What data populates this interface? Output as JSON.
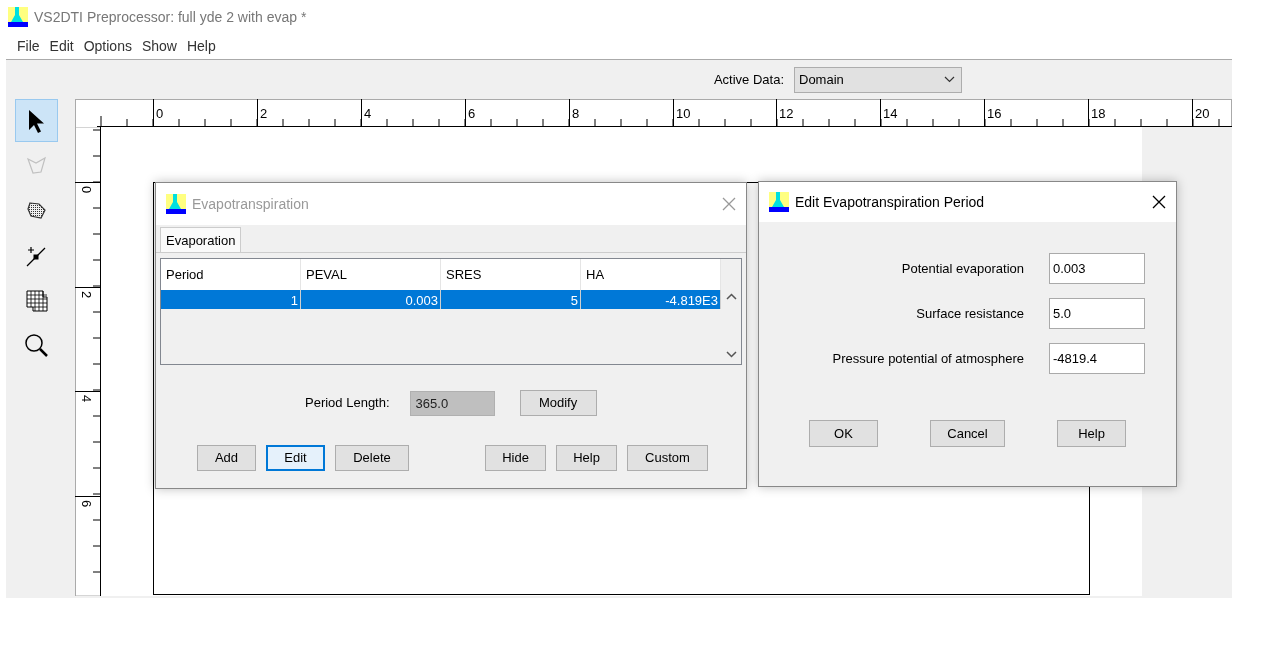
{
  "window": {
    "title": "VS2DTI Preprocessor: full yde 2 with evap *"
  },
  "menu": [
    "File",
    "Edit",
    "Options",
    "Show",
    "Help"
  ],
  "active_data": {
    "label": "Active Data:",
    "value": "Domain"
  },
  "tools": [
    {
      "kind": "pointer",
      "selected": true,
      "disabled": false
    },
    {
      "kind": "polygon",
      "selected": false,
      "disabled": true
    },
    {
      "kind": "filled-polygon",
      "selected": false,
      "disabled": false
    },
    {
      "kind": "point-line",
      "selected": false,
      "disabled": false
    },
    {
      "kind": "grid",
      "selected": false,
      "disabled": false
    },
    {
      "kind": "zoom",
      "selected": false,
      "disabled": false
    }
  ],
  "ruler": {
    "x_labels": [
      "0",
      "2",
      "4",
      "6",
      "8",
      "10",
      "12",
      "14",
      "16",
      "18",
      "20"
    ],
    "y_labels": [
      "0",
      "2",
      "4",
      "6"
    ]
  },
  "evapotranspiration_dialog": {
    "title": "Evapotranspiration",
    "active": false,
    "tabs": [
      {
        "label": "Evaporation",
        "selected": true
      }
    ],
    "table": {
      "columns": [
        "Period",
        "PEVAL",
        "SRES",
        "HA"
      ],
      "rows": [
        {
          "cells": [
            "1",
            "0.003",
            "5",
            "-4.819E3"
          ],
          "selected": true
        }
      ]
    },
    "period_length": {
      "label": "Period Length:",
      "value": "365.0",
      "disabled": true
    },
    "modify_button": "Modify",
    "left_buttons": [
      {
        "label": "Add",
        "focused": false
      },
      {
        "label": "Edit",
        "focused": true
      },
      {
        "label": "Delete",
        "focused": false
      }
    ],
    "right_buttons": [
      {
        "label": "Hide",
        "focused": false
      },
      {
        "label": "Help",
        "focused": false
      },
      {
        "label": "Custom",
        "focused": false
      }
    ]
  },
  "edit_dialog": {
    "title": "Edit Evapotranspiration Period",
    "active": true,
    "fields": [
      {
        "label": "Potential evaporation",
        "value": "0.003"
      },
      {
        "label": "Surface resistance",
        "value": "5.0"
      },
      {
        "label": "Pressure potential of atmosphere",
        "value": "-4819.4"
      }
    ],
    "buttons": [
      "OK",
      "Cancel",
      "Help"
    ]
  }
}
